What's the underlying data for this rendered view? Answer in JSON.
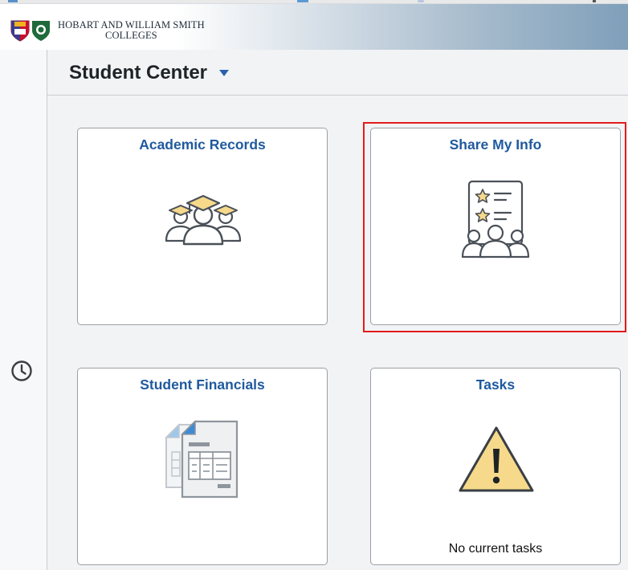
{
  "header": {
    "brand_line1": "HOBART AND WILLIAM SMITH",
    "brand_line2": "COLLEGES"
  },
  "page": {
    "title": "Student Center"
  },
  "tiles": [
    {
      "title": "Academic Records",
      "icon": "graduates-icon"
    },
    {
      "title": "Share My Info",
      "icon": "share-info-icon"
    },
    {
      "title": "Student Financials",
      "icon": "financial-documents-icon"
    },
    {
      "title": "Tasks",
      "icon": "warning-icon",
      "note": "No current tasks"
    }
  ],
  "colors": {
    "accent": "#1f5a9e",
    "focus": "#e31b1b",
    "icon_yellow": "#f6d98b",
    "icon_stroke": "#4a5058"
  }
}
